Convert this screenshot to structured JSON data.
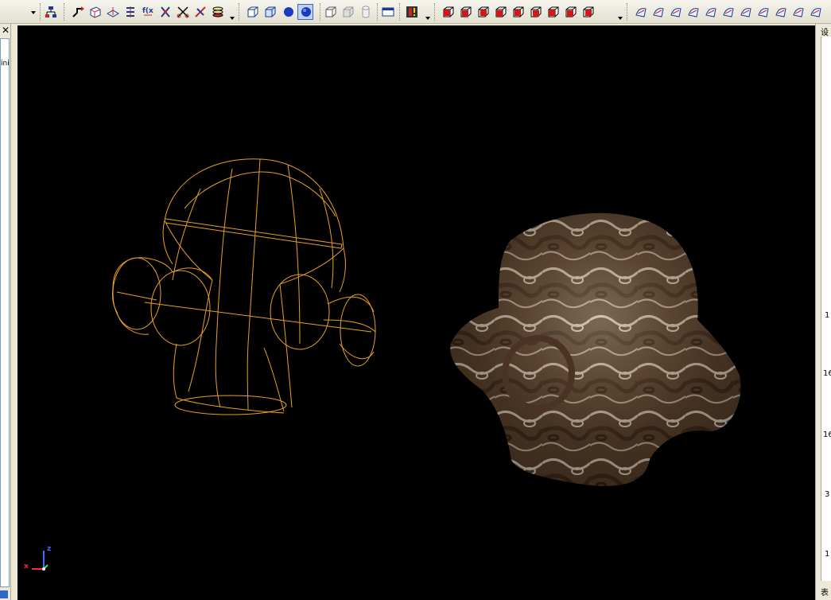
{
  "left_panel": {
    "close_glyph": "✕",
    "label": "ini"
  },
  "right_panel": {
    "header_glyph": "设",
    "values": [
      "1",
      "16",
      "16",
      "3",
      "1"
    ],
    "footer_glyph": "表"
  },
  "viewport": {
    "background": "#000000",
    "wireframe_color": "#e8a020",
    "axis_labels": {
      "x": "x",
      "z": "z"
    },
    "objects": [
      {
        "name": "wireframe-model",
        "display": "wireframe"
      },
      {
        "name": "textured-model",
        "display": "shaded-textured",
        "texture": "marbled-brown"
      }
    ]
  },
  "toolbar": {
    "groups": [
      {
        "name": "tree-tools",
        "icons": [
          "hierarchy-icon"
        ]
      },
      {
        "name": "curve-tools",
        "icons": [
          "arrow-curve-icon",
          "surface-box-icon",
          "plane-icon",
          "split-icon",
          "fx-icon",
          "transform-icon",
          "scissors-icon",
          "align-icon",
          "layers-icon"
        ]
      },
      {
        "name": "display-mode",
        "icons": [
          "box-outline-icon",
          "box-solid-icon",
          "sphere-icon",
          "sphere-shaded-icon"
        ]
      },
      {
        "name": "view-filter",
        "icons": [
          "cube-gray-icon",
          "cube-gray-2-icon",
          "cylinder-gray-icon"
        ]
      },
      {
        "name": "window",
        "icons": [
          "window-icon"
        ]
      },
      {
        "name": "render",
        "icons": [
          "render-icon"
        ]
      },
      {
        "name": "views",
        "icons": [
          "view-iso-icon",
          "view-front-icon",
          "view-back-icon",
          "view-left-icon",
          "view-right-icon",
          "view-top-icon",
          "view-bottom-icon",
          "view-persp-icon",
          "view-normal-icon"
        ]
      },
      {
        "name": "shape-tools",
        "icons": [
          "shape-1-icon",
          "shape-2-icon",
          "shape-3-icon",
          "shape-4-icon",
          "shape-5-icon",
          "shape-6-icon",
          "shape-7-icon",
          "shape-8-icon",
          "shape-9-icon",
          "shape-10-icon",
          "shape-11-icon"
        ]
      }
    ]
  }
}
